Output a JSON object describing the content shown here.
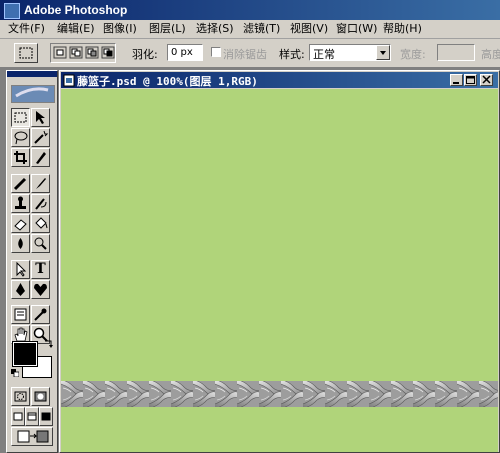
{
  "app": {
    "title": "Adobe Photoshop"
  },
  "menu": {
    "items": [
      "文件(F)",
      "编辑(E)",
      "图像(I)",
      "图层(L)",
      "选择(S)",
      "滤镜(T)",
      "视图(V)",
      "窗口(W)",
      "帮助(H)"
    ]
  },
  "options": {
    "feather_label": "羽化:",
    "feather_value": "0 px",
    "antialias_label": "消除锯齿",
    "style_label": "样式:",
    "style_value": "正常",
    "width_label": "宽度:",
    "height_label": "高度"
  },
  "document": {
    "title": "藤篮子.psd @ 100%(图层 1,RGB)",
    "background_color": "#b0d47a"
  },
  "toolbox": {
    "tools": [
      "rectangular-marquee-icon",
      "move-icon",
      "lasso-icon",
      "magic-wand-icon",
      "crop-icon",
      "slice-icon",
      "healing-brush-icon",
      "brush-icon",
      "clone-stamp-icon",
      "history-brush-icon",
      "eraser-icon",
      "paint-bucket-icon",
      "blur-icon",
      "dodge-icon",
      "path-selection-icon",
      "type-icon",
      "pen-icon",
      "custom-shape-icon",
      "notes-icon",
      "eyedropper-icon",
      "hand-icon",
      "zoom-icon"
    ],
    "type_glyph": "T",
    "foreground_color": "#000000",
    "background_color": "#ffffff"
  }
}
